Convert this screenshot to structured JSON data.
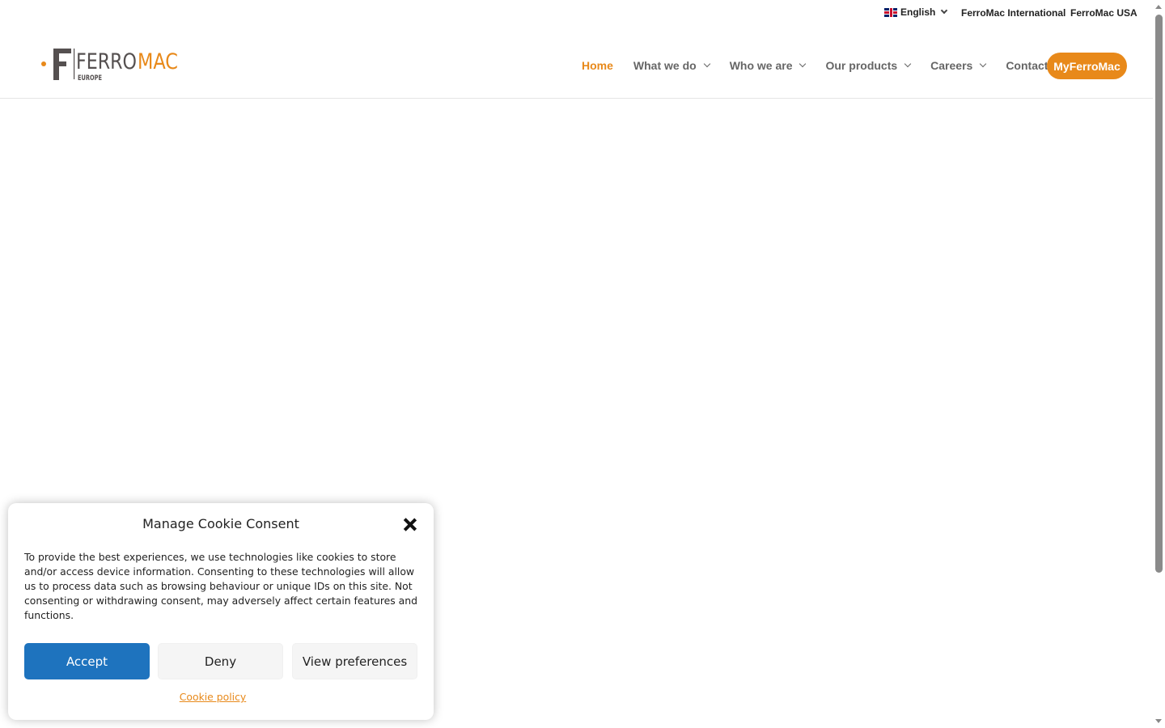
{
  "topbar": {
    "language": "English",
    "links": [
      "FerroMac International",
      "FerroMac USA"
    ]
  },
  "logo": {
    "word_left": "FERRO",
    "word_right": "MAC",
    "sub": "EUROPE"
  },
  "nav": {
    "items": [
      {
        "label": "Home"
      },
      {
        "label": "What we do"
      },
      {
        "label": "Who we are"
      },
      {
        "label": "Our products"
      },
      {
        "label": "Careers"
      },
      {
        "label": "Contact"
      }
    ],
    "cta": "MyFerroMac"
  },
  "colors": {
    "accent": "#e8891a",
    "accept": "#1e73be",
    "logo_dark": "#555050"
  },
  "cookie": {
    "title": "Manage Cookie Consent",
    "body": "To provide the best experiences, we use technologies like cookies to store and/or access device information. Consenting to these technologies will allow us to process data such as browsing behaviour or unique IDs on this site. Not consenting or withdrawing consent, may adversely affect certain features and functions.",
    "accept": "Accept",
    "deny": "Deny",
    "preferences": "View preferences",
    "policy": "Cookie policy"
  }
}
